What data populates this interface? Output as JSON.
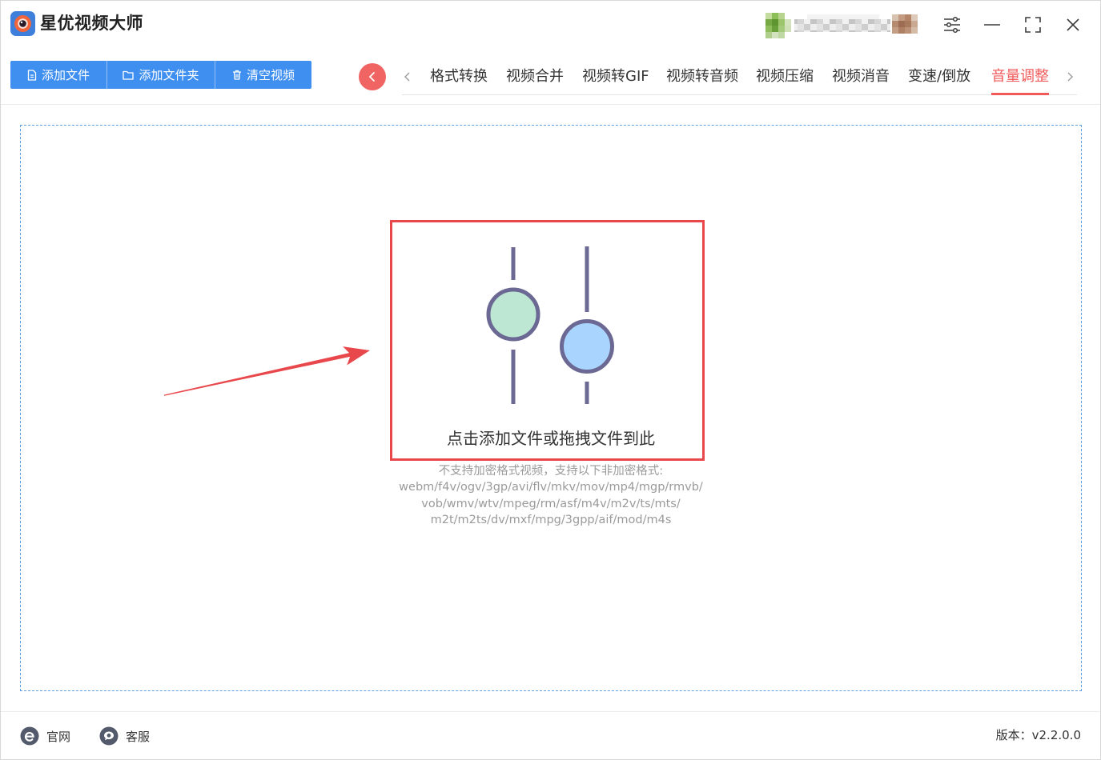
{
  "app": {
    "title": "星优视频大师",
    "logo_icon": "app-logo-icon"
  },
  "window_controls": {
    "settings_icon": "sliders-icon",
    "minimize_icon": "minimize-icon",
    "maximize_icon": "maximize-icon",
    "close_icon": "close-icon"
  },
  "toolbar": {
    "buttons": [
      {
        "label": "添加文件",
        "icon": "file-icon"
      },
      {
        "label": "添加文件夹",
        "icon": "folder-icon"
      },
      {
        "label": "清空视频",
        "icon": "trash-icon"
      }
    ]
  },
  "nav": {
    "back_icon": "chevron-left-icon",
    "scroll_left_icon": "chevron-left-icon",
    "scroll_right_icon": "chevron-right-icon",
    "tabs": [
      {
        "label": "格式转换",
        "active": false
      },
      {
        "label": "视频合并",
        "active": false
      },
      {
        "label": "视频转GIF",
        "active": false
      },
      {
        "label": "视频转音频",
        "active": false
      },
      {
        "label": "视频压缩",
        "active": false
      },
      {
        "label": "视频消音",
        "active": false
      },
      {
        "label": "变速/倒放",
        "active": false
      },
      {
        "label": "音量调整",
        "active": true
      }
    ]
  },
  "drop_zone": {
    "icon": "volume-sliders-icon",
    "prompt": "点击添加文件或拖拽文件到此",
    "notice": "不支持加密格式视频，支持以下非加密格式:",
    "formats": [
      "webm/f4v/ogv/3gp/avi/flv/mkv/mov/mp4/mgp/rmvb/",
      "vob/wmv/wtv/mpeg/rm/asf/m4v/m2v/ts/mts/",
      "m2t/m2ts/dv/mxf/mpg/3gpp/aif/mod/m4s"
    ]
  },
  "footer": {
    "links": [
      {
        "label": "官网",
        "icon": "ie-browser-icon"
      },
      {
        "label": "客服",
        "icon": "chat-bubble-icon"
      }
    ],
    "version": "版本：v2.2.0.0"
  },
  "colors": {
    "accent": "#3f8ff0",
    "active_tab": "#f05a5a",
    "back_button": "#f06464",
    "annotation": "#e8474b",
    "icon_stroke": "#6b6993",
    "slider_green": "#bde6d3",
    "slider_blue": "#a8d4fe",
    "dropzone_border": "#5d9fe0"
  }
}
